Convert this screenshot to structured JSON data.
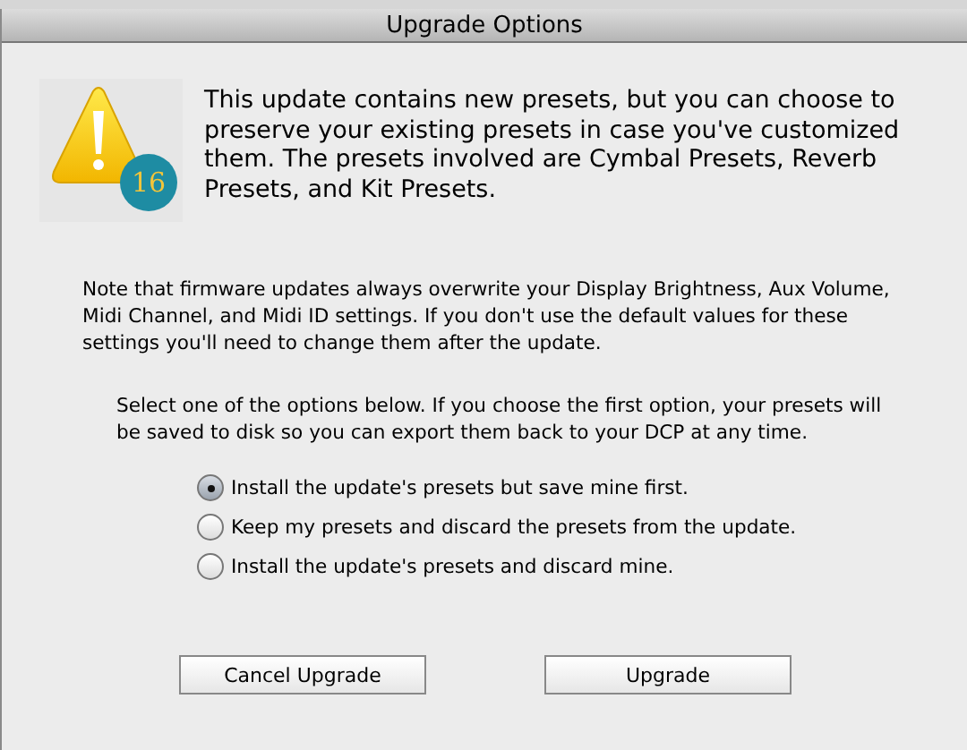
{
  "window": {
    "title": "Upgrade Options"
  },
  "alert": {
    "badge": "16",
    "message": "This update contains new presets, but you can choose to preserve your existing presets in case you've customized them. The presets involved are Cymbal Presets, Reverb Presets, and Kit Presets."
  },
  "note": "Note that firmware updates always overwrite your Display Brightness, Aux Volume, Midi Channel, and Midi ID settings. If you don't use the default values for these settings you'll need to change them after the update.",
  "instruction": "Select one of the options below. If you choose the first option, your presets will be saved to disk so you can export them back to your DCP at any time.",
  "options": [
    {
      "label": "Install the update's presets but save mine first.",
      "selected": true
    },
    {
      "label": "Keep my presets and discard the presets from the update.",
      "selected": false
    },
    {
      "label": "Install the update's presets and discard mine.",
      "selected": false
    }
  ],
  "buttons": [
    "Cancel Upgrade",
    "Upgrade"
  ]
}
